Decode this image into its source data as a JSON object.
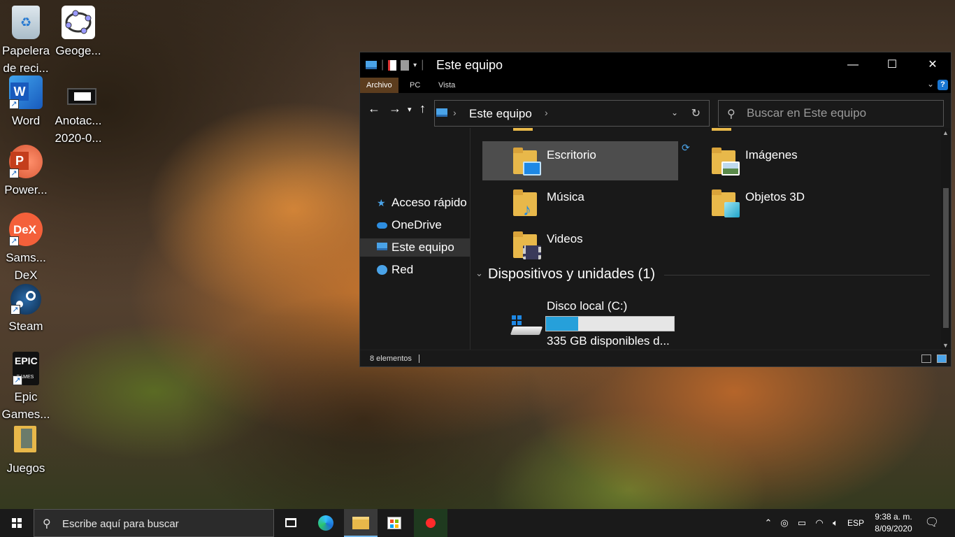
{
  "desktop": {
    "icons": [
      {
        "label": "Papelera de reci..."
      },
      {
        "label": "Geoge..."
      },
      {
        "label": "Word"
      },
      {
        "label": "Anotac... 2020-0..."
      },
      {
        "label": "Power..."
      },
      {
        "label": "Sams... DeX"
      },
      {
        "label": "Steam"
      },
      {
        "label": "Epic Games..."
      },
      {
        "label": "Juegos"
      }
    ]
  },
  "explorer": {
    "title": "Este equipo",
    "ribbon_tabs": [
      "Archivo",
      "PC",
      "Vista"
    ],
    "address": {
      "crumb": "Este equipo"
    },
    "search": {
      "placeholder": "Buscar en Este equipo"
    },
    "nav_items": [
      {
        "label": "Acceso rápido",
        "icon": "star-icon"
      },
      {
        "label": "OneDrive",
        "icon": "cloud-icon"
      },
      {
        "label": "Este equipo",
        "icon": "computer-icon",
        "selected": true
      },
      {
        "label": "Red",
        "icon": "network-icon"
      }
    ],
    "folders": [
      {
        "name": "Escritorio",
        "badge": "desktop"
      },
      {
        "name": "Imágenes",
        "badge": "pictures"
      },
      {
        "name": "Música",
        "badge": "music"
      },
      {
        "name": "Objetos 3D",
        "badge": "3d-objects"
      },
      {
        "name": "Videos",
        "badge": "videos"
      }
    ],
    "devices_group": {
      "label": "Dispositivos y unidades (1)"
    },
    "drive": {
      "name": "Disco local (C:)",
      "free": "335 GB disponibles d...",
      "used_fraction": 0.25
    },
    "status": {
      "count": "8 elementos"
    }
  },
  "taskbar": {
    "search_placeholder": "Escribe aquí para buscar",
    "lang": "ESP",
    "time": "9:38 a. m.",
    "date": "8/09/2020"
  },
  "colors": {
    "accent": "#26a0da",
    "ribbon_active": "#5c3d1e",
    "window_bg": "#191919",
    "taskbar_bg": "#1a1a1a"
  }
}
